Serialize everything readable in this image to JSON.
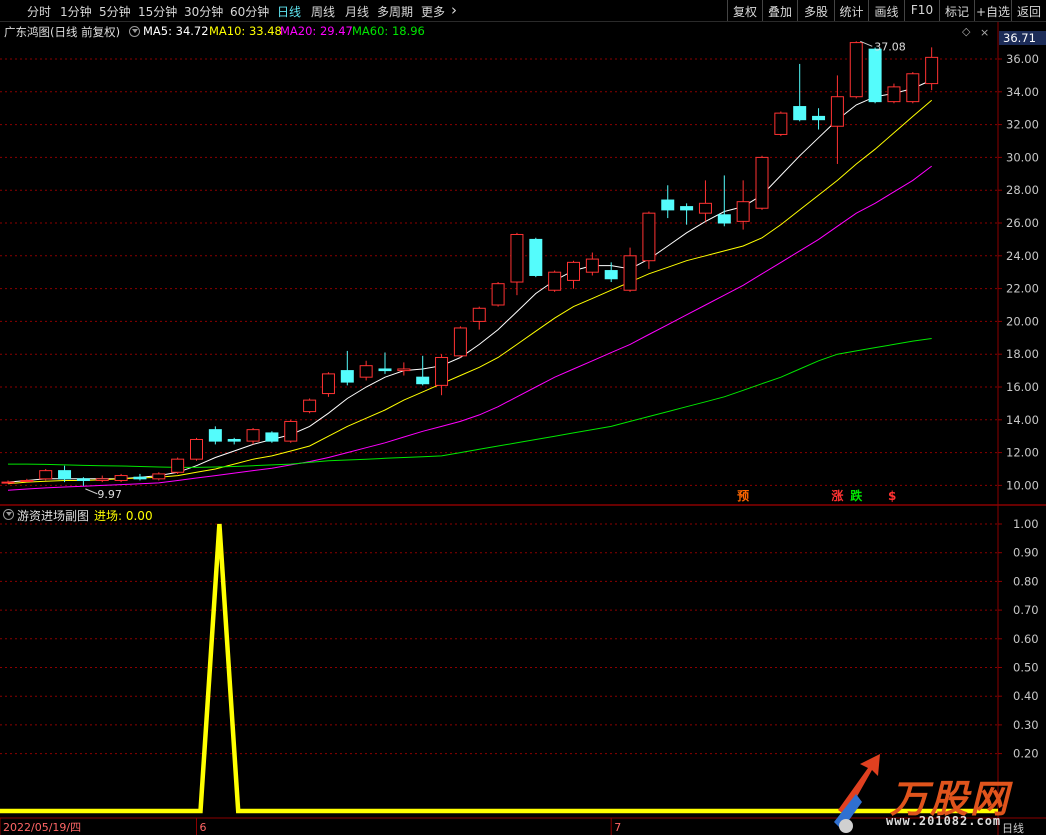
{
  "toolbar": {
    "periods": [
      "分时",
      "1分钟",
      "5分钟",
      "15分钟",
      "30分钟",
      "60分钟",
      "日线",
      "周线",
      "月线",
      "多周期",
      "更多"
    ],
    "active_period": "日线",
    "tools": [
      "复权",
      "叠加",
      "多股",
      "统计",
      "画线",
      "F10",
      "标记",
      "+自选",
      "返回"
    ]
  },
  "main": {
    "title": "广东鸿图(日线 前复权)",
    "ma5": "MA5: 34.72",
    "ma10": "MA10: 33.48",
    "ma20": "MA20: 29.47",
    "ma60": "MA60: 18.96",
    "price_tag": "36.71",
    "high_label": "37.08",
    "low_label": "9.97",
    "y_ticks": [
      "36.00",
      "34.00",
      "32.00",
      "30.00",
      "28.00",
      "26.00",
      "24.00",
      "22.00",
      "20.00",
      "18.00",
      "16.00",
      "14.00",
      "12.00",
      "10.00"
    ],
    "markers": [
      "预",
      "涨",
      "跌",
      "$"
    ]
  },
  "sub": {
    "title": "游资进场副图",
    "indicator": "进场: 0.00",
    "y_ticks": [
      "1.00",
      "0.90",
      "0.80",
      "0.70",
      "0.60",
      "0.50",
      "0.40",
      "0.30",
      "0.20"
    ]
  },
  "xaxis": {
    "labels": [
      "2022/05/19/四",
      "6",
      "7"
    ],
    "period_label": "日线"
  },
  "watermark": {
    "title": "万股网",
    "url": "www.201082.com"
  },
  "colors": {
    "up": "#ff3232",
    "down": "#54fcfc",
    "ma5": "#ffffff",
    "ma10": "#ffff00",
    "ma20": "#ff00ff",
    "ma60": "#00e600",
    "signal": "#ffff00",
    "grid": "#8b0000",
    "axis_text": "#c8c8c8"
  },
  "chart_data": [
    {
      "type": "candlestick",
      "title": "广东鸿图(日线 前复权)",
      "ylim": [
        9.2,
        37.5
      ],
      "y_ticks": [
        36,
        34,
        32,
        30,
        28,
        26,
        24,
        22,
        20,
        18,
        16,
        14,
        12,
        10
      ],
      "x_labels": {
        "0": "2022/05/19/四",
        "10": "6",
        "32": "7"
      },
      "candles": [
        [
          10.2,
          10.2,
          10.3,
          10.1
        ],
        [
          10.3,
          10.3,
          10.4,
          10.2
        ],
        [
          10.4,
          10.9,
          11.0,
          10.3
        ],
        [
          10.9,
          10.4,
          11.2,
          10.2
        ],
        [
          10.4,
          10.3,
          10.5,
          9.97
        ],
        [
          10.3,
          10.4,
          10.6,
          10.2
        ],
        [
          10.3,
          10.6,
          10.7,
          10.2
        ],
        [
          10.5,
          10.4,
          10.7,
          10.3
        ],
        [
          10.4,
          10.7,
          10.8,
          10.3
        ],
        [
          10.8,
          11.6,
          11.7,
          10.7
        ],
        [
          11.6,
          12.8,
          12.9,
          11.5
        ],
        [
          13.4,
          12.7,
          13.6,
          12.5
        ],
        [
          12.8,
          12.7,
          12.9,
          12.5
        ],
        [
          12.7,
          13.4,
          13.5,
          12.5
        ],
        [
          13.2,
          12.7,
          13.3,
          12.6
        ],
        [
          12.7,
          13.9,
          14.0,
          12.6
        ],
        [
          14.5,
          15.2,
          15.3,
          14.4
        ],
        [
          15.6,
          16.8,
          16.9,
          15.4
        ],
        [
          17.0,
          16.3,
          18.2,
          16.1
        ],
        [
          16.6,
          17.3,
          17.6,
          16.4
        ],
        [
          17.1,
          17.0,
          18.1,
          16.8
        ],
        [
          17.0,
          17.1,
          17.5,
          16.7
        ],
        [
          16.6,
          16.2,
          17.9,
          16.1
        ],
        [
          16.1,
          17.8,
          18.0,
          15.5
        ],
        [
          17.9,
          19.6,
          19.7,
          17.8
        ],
        [
          20.0,
          20.8,
          20.9,
          19.5
        ],
        [
          21.0,
          22.3,
          22.4,
          20.9
        ],
        [
          22.4,
          25.3,
          25.4,
          21.6
        ],
        [
          25.0,
          22.8,
          25.1,
          22.7
        ],
        [
          21.9,
          23.0,
          23.1,
          21.8
        ],
        [
          22.5,
          23.6,
          23.7,
          22.0
        ],
        [
          23.0,
          23.8,
          24.2,
          22.8
        ],
        [
          23.1,
          22.6,
          23.6,
          22.4
        ],
        [
          21.9,
          24.0,
          24.5,
          21.8
        ],
        [
          23.7,
          26.6,
          26.7,
          23.2
        ],
        [
          27.4,
          26.8,
          28.3,
          26.3
        ],
        [
          27.0,
          26.8,
          27.2,
          25.9
        ],
        [
          26.6,
          27.2,
          28.6,
          26.1
        ],
        [
          26.5,
          26.0,
          28.9,
          25.8
        ],
        [
          26.1,
          27.3,
          28.6,
          25.6
        ],
        [
          26.9,
          30.0,
          30.1,
          26.8
        ],
        [
          31.4,
          32.7,
          32.8,
          31.3
        ],
        [
          33.1,
          32.3,
          35.7,
          32.2
        ],
        [
          32.5,
          32.3,
          33.0,
          31.7
        ],
        [
          31.9,
          33.7,
          35.0,
          29.6
        ],
        [
          33.7,
          37.0,
          37.08,
          33.6
        ],
        [
          36.6,
          33.4,
          36.7,
          33.3
        ],
        [
          33.4,
          34.3,
          34.5,
          33.3
        ],
        [
          33.4,
          35.1,
          35.2,
          33.3
        ],
        [
          34.5,
          36.1,
          36.71,
          34.1
        ]
      ],
      "series": [
        {
          "name": "MA5",
          "values": [
            10.2,
            10.3,
            10.4,
            10.4,
            10.4,
            10.4,
            10.4,
            10.5,
            10.6,
            10.8,
            11.2,
            11.7,
            12.1,
            12.5,
            12.8,
            13.1,
            13.6,
            14.4,
            15.3,
            16.0,
            16.6,
            17.0,
            17.1,
            17.3,
            17.8,
            18.6,
            19.5,
            20.6,
            21.7,
            22.5,
            23.1,
            23.4,
            23.4,
            23.2,
            23.8,
            24.6,
            25.4,
            26.1,
            26.7,
            27.0,
            27.7,
            28.9,
            30.1,
            31.2,
            32.3,
            33.2,
            33.7,
            33.9,
            34.2,
            34.72
          ]
        },
        {
          "name": "MA10",
          "values": [
            10.1,
            10.2,
            10.25,
            10.3,
            10.3,
            10.35,
            10.4,
            10.45,
            10.5,
            10.6,
            10.8,
            11.0,
            11.3,
            11.6,
            11.8,
            12.1,
            12.4,
            13.0,
            13.6,
            14.1,
            14.6,
            15.2,
            15.7,
            16.2,
            16.7,
            17.2,
            17.8,
            18.6,
            19.4,
            20.2,
            20.9,
            21.4,
            21.9,
            22.4,
            22.9,
            23.3,
            23.7,
            24.0,
            24.3,
            24.6,
            25.1,
            25.9,
            26.8,
            27.7,
            28.6,
            29.6,
            30.5,
            31.5,
            32.5,
            33.48
          ]
        },
        {
          "name": "MA20",
          "values": [
            9.7,
            9.78,
            9.85,
            9.9,
            9.95,
            10.0,
            10.05,
            10.1,
            10.15,
            10.3,
            10.45,
            10.6,
            10.75,
            10.9,
            11.05,
            11.25,
            11.45,
            11.7,
            12.0,
            12.3,
            12.6,
            12.95,
            13.3,
            13.6,
            13.9,
            14.3,
            14.8,
            15.4,
            16.0,
            16.6,
            17.1,
            17.6,
            18.1,
            18.6,
            19.2,
            19.8,
            20.4,
            21.0,
            21.6,
            22.2,
            22.9,
            23.6,
            24.3,
            25.0,
            25.8,
            26.6,
            27.2,
            27.9,
            28.6,
            29.47
          ]
        },
        {
          "name": "MA60",
          "values": [
            11.3,
            11.3,
            11.28,
            11.25,
            11.22,
            11.2,
            11.18,
            11.15,
            11.12,
            11.1,
            11.1,
            11.12,
            11.15,
            11.2,
            11.25,
            11.3,
            11.4,
            11.5,
            11.55,
            11.6,
            11.65,
            11.7,
            11.75,
            11.8,
            12.0,
            12.2,
            12.4,
            12.6,
            12.8,
            13.0,
            13.2,
            13.4,
            13.6,
            13.9,
            14.2,
            14.5,
            14.8,
            15.1,
            15.4,
            15.8,
            16.2,
            16.6,
            17.1,
            17.6,
            18.0,
            18.2,
            18.4,
            18.6,
            18.8,
            18.96
          ]
        }
      ],
      "markers": [
        {
          "index": 39,
          "text": "预",
          "color": "#ff6600"
        },
        {
          "index": 44,
          "text": "涨",
          "color": "#ff3232"
        },
        {
          "index": 45,
          "text": "跌",
          "color": "#00e600"
        },
        {
          "index": 47,
          "text": "$",
          "color": "#ff3232"
        }
      ]
    },
    {
      "type": "line",
      "title": "游资进场副图",
      "series": [
        {
          "name": "进场",
          "values": [
            0,
            0,
            0,
            0,
            0,
            0,
            0,
            0,
            0,
            0,
            0,
            1,
            0,
            0,
            0,
            0,
            0,
            0,
            0,
            0,
            0,
            0,
            0,
            0,
            0,
            0,
            0,
            0,
            0,
            0,
            0,
            0,
            0,
            0,
            0,
            0,
            0,
            0,
            0,
            0,
            0,
            0,
            0,
            0,
            0,
            0,
            0,
            0,
            0,
            0
          ]
        }
      ],
      "ylim": [
        0,
        1.0
      ],
      "y_ticks": [
        1.0,
        0.9,
        0.8,
        0.7,
        0.6,
        0.5,
        0.4,
        0.3,
        0.2
      ]
    }
  ]
}
